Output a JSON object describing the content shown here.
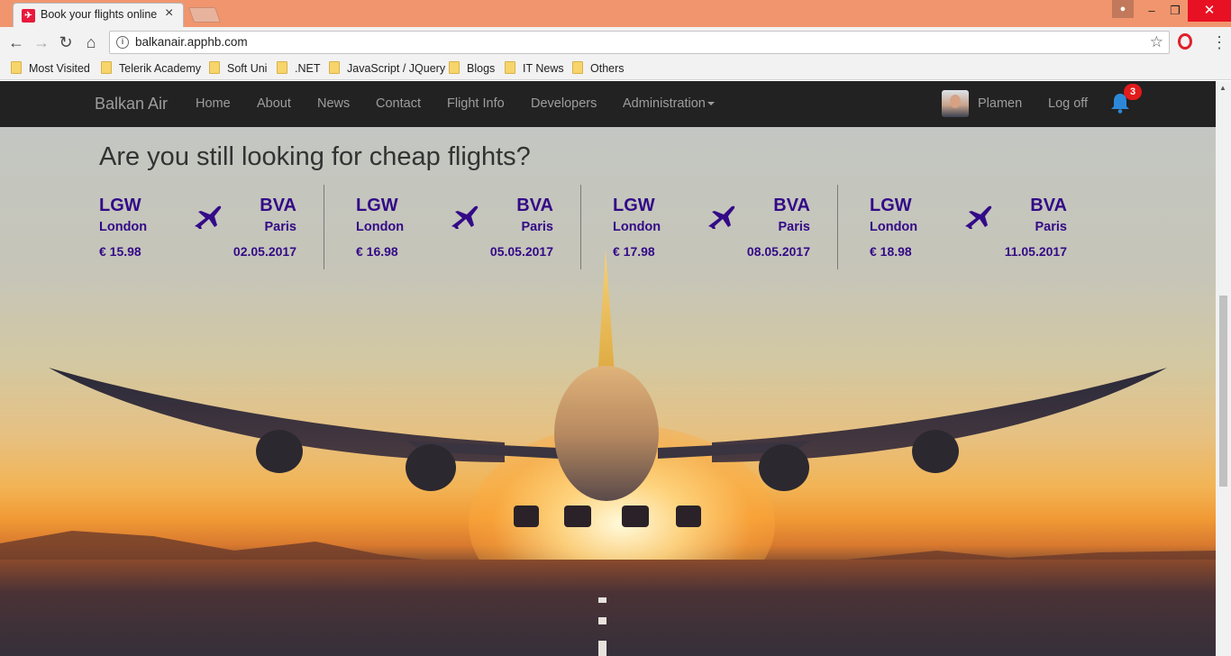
{
  "browser": {
    "tab_title": "Book your flights online",
    "tab_close": "×",
    "url": "balkanair.apphb.com",
    "window_controls": {
      "minimize": "–",
      "restore": "❐",
      "close": "✕"
    },
    "nav_icons": {
      "back": "←",
      "forward": "→",
      "reload": "↻",
      "home": "⌂",
      "star": "☆",
      "menu": "⋮"
    },
    "bookmarks": [
      "Most Visited",
      "Telerik Academy",
      "Soft Uni",
      ".NET",
      "JavaScript / JQuery",
      "Blogs",
      "IT News",
      "Others"
    ]
  },
  "navbar": {
    "brand": "Balkan Air",
    "links": [
      "Home",
      "About",
      "News",
      "Contact",
      "Flight Info",
      "Developers",
      "Administration"
    ],
    "user_name": "Plamen",
    "logoff": "Log off",
    "notification_count": "3"
  },
  "hero": {
    "heading": "Are you still looking for cheap flights?",
    "deals": [
      {
        "from_code": "LGW",
        "from_city": "London",
        "to_code": "BVA",
        "to_city": "Paris",
        "price": "€ 15.98",
        "date": "02.05.2017"
      },
      {
        "from_code": "LGW",
        "from_city": "London",
        "to_code": "BVA",
        "to_city": "Paris",
        "price": "€ 16.98",
        "date": "05.05.2017"
      },
      {
        "from_code": "LGW",
        "from_city": "London",
        "to_code": "BVA",
        "to_city": "Paris",
        "price": "€ 17.98",
        "date": "08.05.2017"
      },
      {
        "from_code": "LGW",
        "from_city": "London",
        "to_code": "BVA",
        "to_city": "Paris",
        "price": "€ 18.98",
        "date": "11.05.2017"
      }
    ]
  },
  "colors": {
    "deal_text": "#330a87",
    "navbar_bg": "#222222",
    "badge": "#e21b1b",
    "bell": "#2d89d8"
  }
}
